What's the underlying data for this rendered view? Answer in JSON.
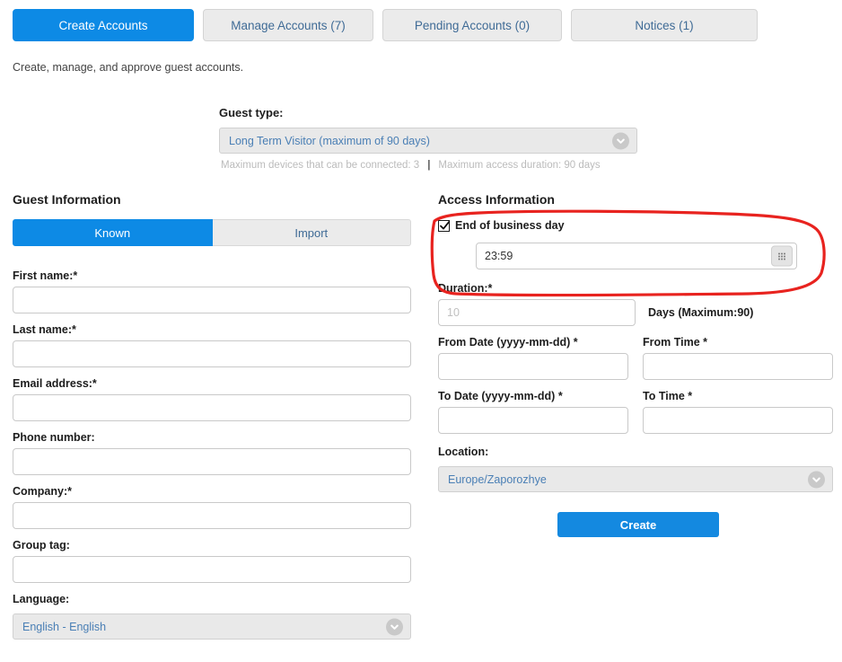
{
  "tabs": [
    {
      "label": "Create Accounts",
      "active": true
    },
    {
      "label": "Manage Accounts (7)",
      "active": false
    },
    {
      "label": "Pending Accounts (0)",
      "active": false
    },
    {
      "label": "Notices (1)",
      "active": false
    }
  ],
  "page": {
    "description": "Create, manage, and approve guest accounts."
  },
  "guest_type": {
    "label": "Guest type:",
    "selected": "Long Term Visitor (maximum of 90 days)",
    "hint_devices": "Maximum devices that can be connected: 3",
    "hint_separator": "|",
    "hint_duration": "Maximum access duration: 90 days",
    "chevron_icon": "chevron-down-icon"
  },
  "guest_information": {
    "title": "Guest Information",
    "segmented": {
      "known_label": "Known",
      "import_label": "Import"
    },
    "fields": [
      {
        "label": "First name:*",
        "value": "",
        "placeholder": ""
      },
      {
        "label": "Last name:*",
        "value": "",
        "placeholder": ""
      },
      {
        "label": "Email address:*",
        "value": "",
        "placeholder": ""
      },
      {
        "label": "Phone number:",
        "value": "",
        "placeholder": ""
      },
      {
        "label": "Company:*",
        "value": "",
        "placeholder": ""
      },
      {
        "label": "Group tag:",
        "value": "",
        "placeholder": ""
      }
    ],
    "language": {
      "label": "Language:",
      "selected": "English - English"
    }
  },
  "access_information": {
    "title": "Access Information",
    "end_of_business_day": {
      "label": "End of business day",
      "checked": true
    },
    "time": {
      "value": "23:59",
      "picker_icon": "calendar-grid-icon"
    },
    "duration": {
      "label": "Duration:*",
      "placeholder": "10",
      "value": "",
      "units": "Days (Maximum:90)"
    },
    "from_date": {
      "label": "From Date (yyyy-mm-dd) *",
      "value": "",
      "placeholder": ""
    },
    "from_time": {
      "label": "From Time *",
      "value": "",
      "placeholder": ""
    },
    "to_date": {
      "label": "To Date (yyyy-mm-dd) *",
      "value": "",
      "placeholder": ""
    },
    "to_time": {
      "label": "To Time *",
      "value": "",
      "placeholder": ""
    },
    "location": {
      "label": "Location:",
      "selected": "Europe/Zaporozhye"
    },
    "create_button": "Create"
  },
  "annotation": {
    "shape": "hand-drawn-oval",
    "color": "#e8231f",
    "targets": "End of business day checkbox and 23:59 time field"
  },
  "colors": {
    "accent_blue": "#0d8ae5",
    "button_blue": "#1489e0",
    "tab_inactive_bg": "#ebebeb",
    "tab_inactive_text": "#3f6b96",
    "select_bg": "#e9e9e9",
    "select_text": "#4a7fb5",
    "hint_text": "#bbbbbb",
    "annotation_red": "#e8231f"
  }
}
